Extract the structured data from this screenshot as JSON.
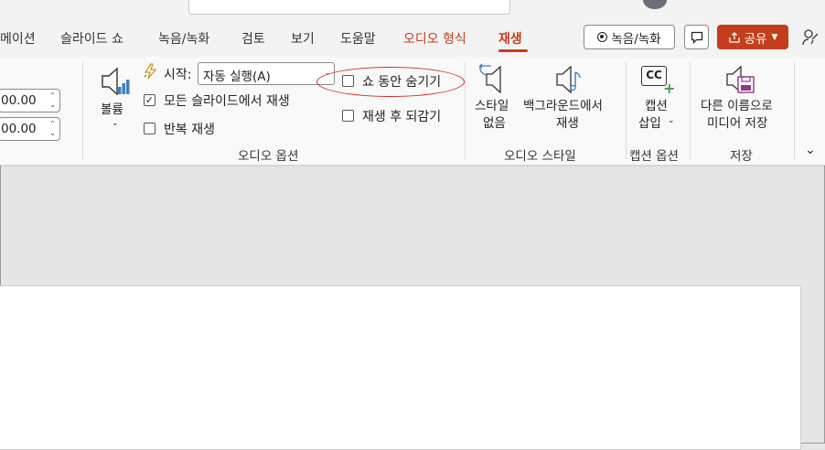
{
  "colors": {
    "accent": "#c43e1c",
    "ribbon_bg": "#f9f9f9",
    "workspace_bg": "#e6e6e6",
    "highlight": "#c9302c"
  },
  "tabs": [
    {
      "label": "메이션"
    },
    {
      "label": "슬라이드 쇼"
    },
    {
      "label": "녹음/녹화"
    },
    {
      "label": "검토"
    },
    {
      "label": "보기"
    },
    {
      "label": "도움말"
    },
    {
      "label": "오디오 형식"
    },
    {
      "label": "재생"
    }
  ],
  "top_buttons": {
    "record": "녹음/녹화",
    "share": "공유"
  },
  "ribbon": {
    "fade_in": "00.00",
    "fade_out": "00.00",
    "volume_label": "볼륨",
    "start_label": "시작:",
    "start_value": "자동 실행(A)",
    "play_across_slides": "모든 슬라이드에서 재생",
    "loop": "반복 재생",
    "hide_during_show": "쇼 동안 숨기기",
    "rewind_after_playing": "재생 후 되감기",
    "group_audio_options": "오디오 옵션",
    "no_style_line1": "스타일",
    "no_style_line2": "없음",
    "background_line1": "백그라운드에서",
    "background_line2": "재생",
    "group_audio_styles": "오디오 스타일",
    "caption_line1": "캡션",
    "caption_line2": "삽입",
    "group_caption_options": "캡션 옵션",
    "save_as_line1": "다른 이름으로",
    "save_as_line2": "미디어 저장",
    "group_save": "저장",
    "cc_badge": "CC"
  }
}
